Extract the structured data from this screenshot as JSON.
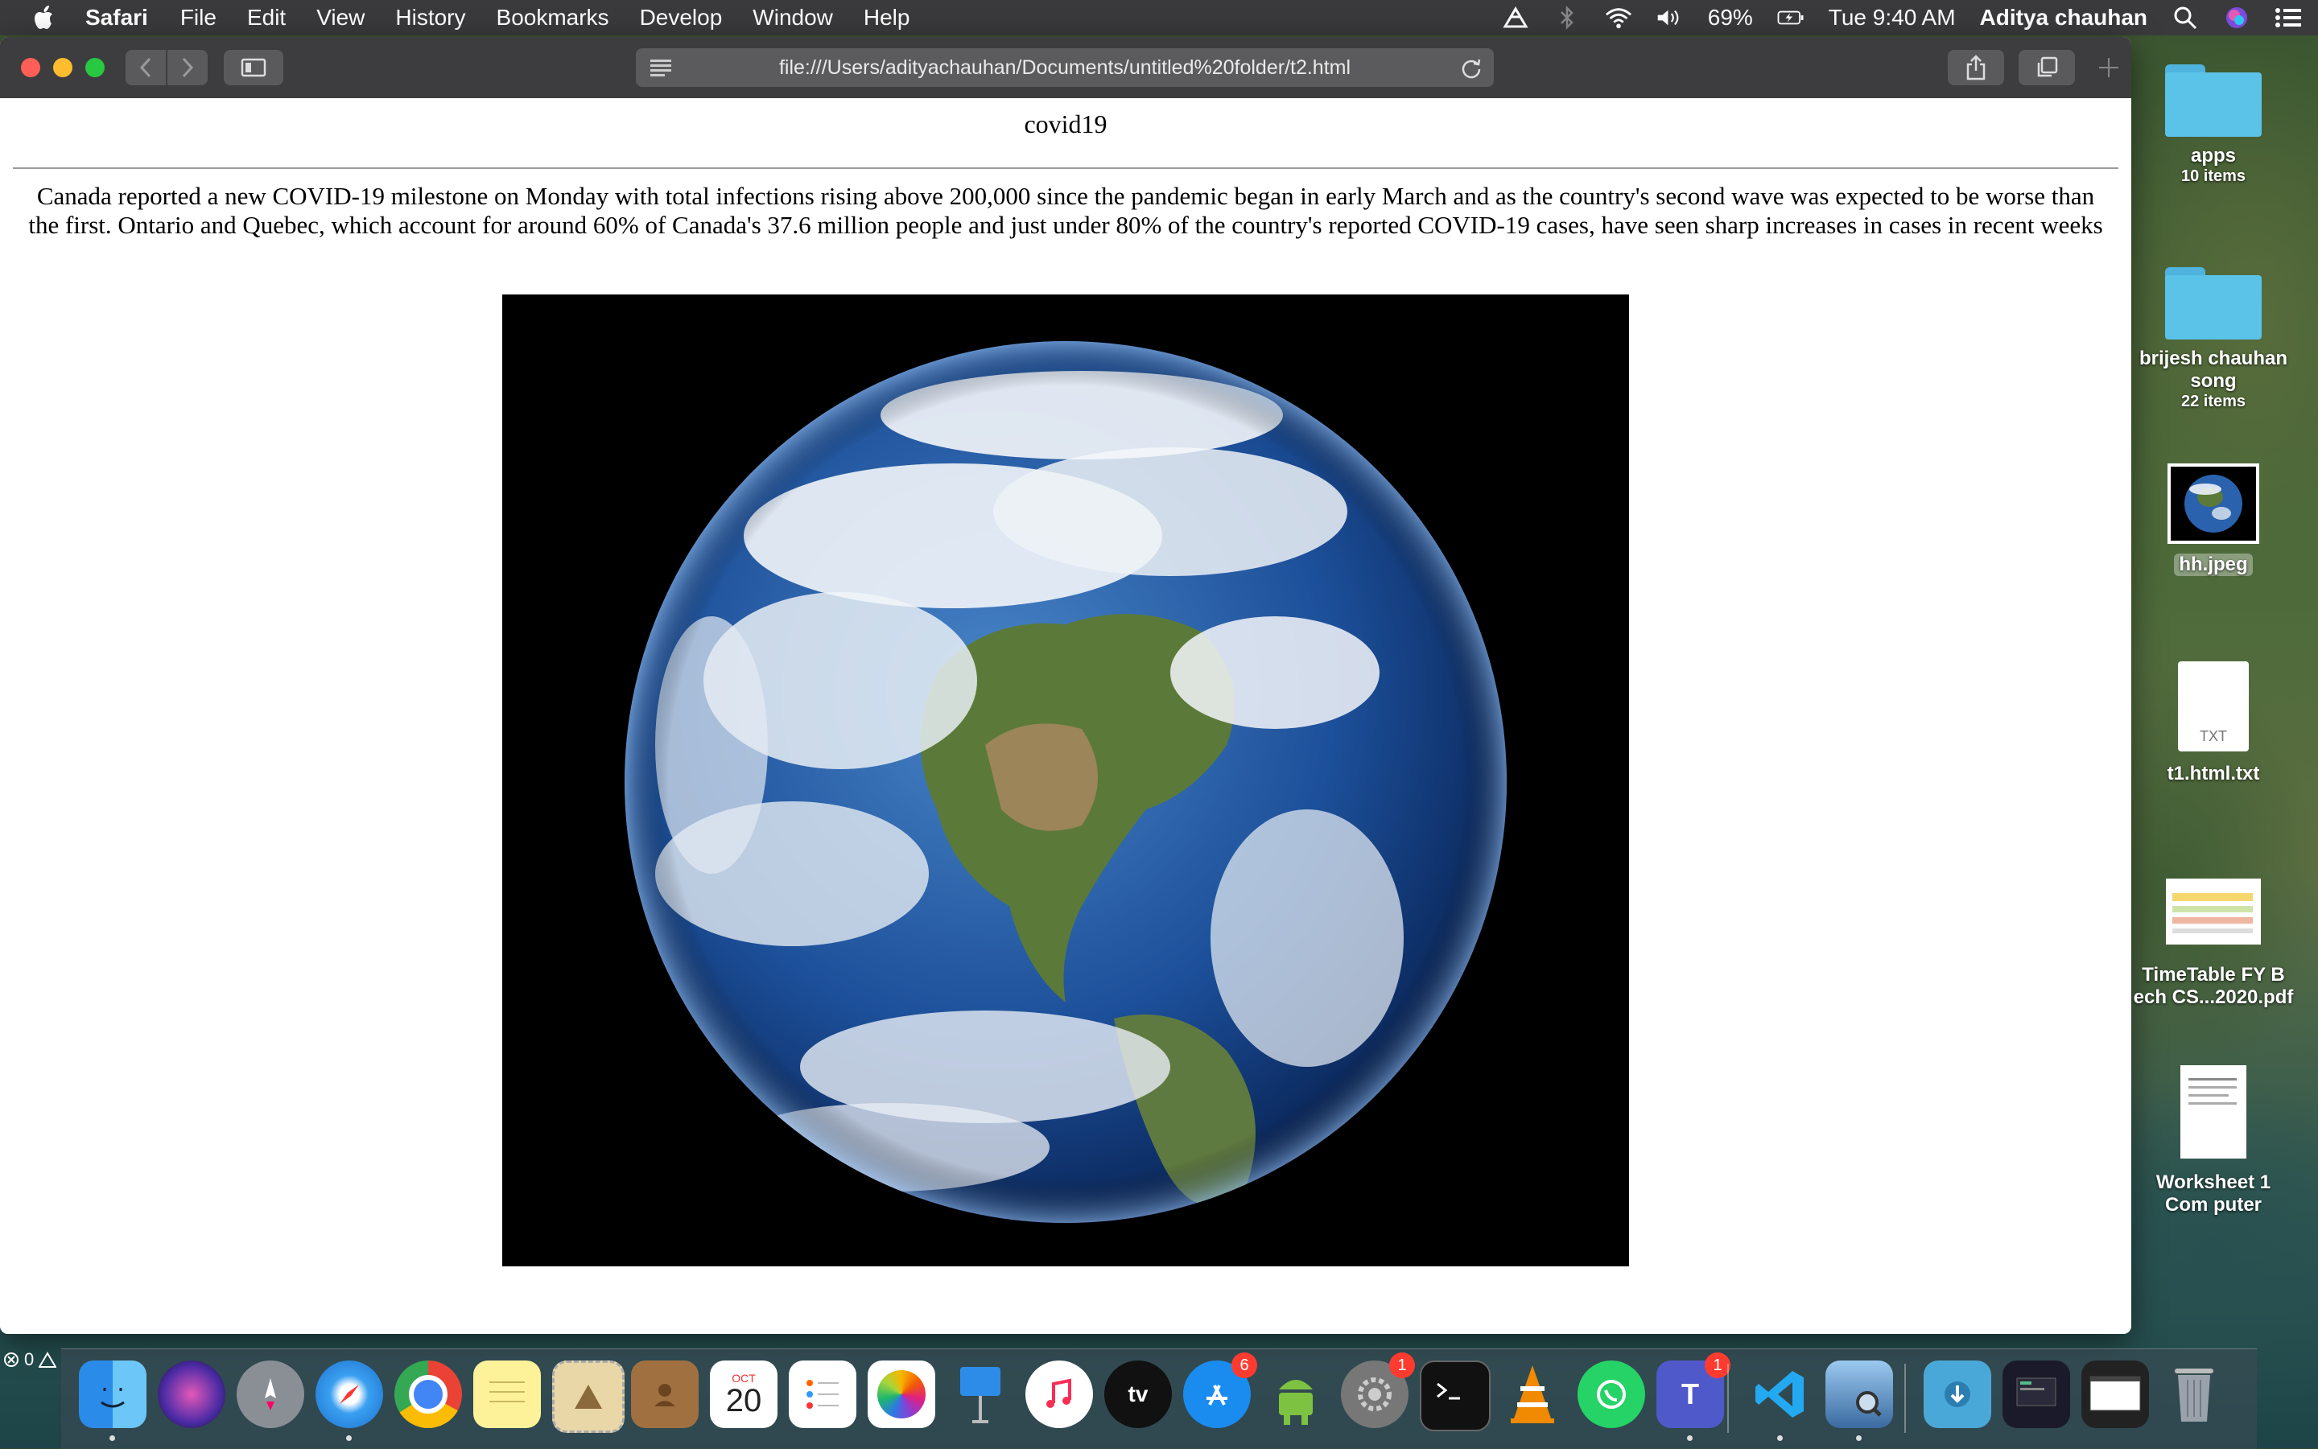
{
  "menubar": {
    "app_name": "Safari",
    "items": [
      "File",
      "Edit",
      "View",
      "History",
      "Bookmarks",
      "Develop",
      "Window",
      "Help"
    ],
    "battery": "69%",
    "clock": "Tue 9:40 AM",
    "user": "Aditya chauhan"
  },
  "browser": {
    "url": "file:///Users/adityachauhan/Documents/untitled%20folder/t2.html"
  },
  "page": {
    "title": "covid19",
    "paragraph": "Canada reported a new COVID-19 milestone on Monday with total infections rising above 200,000 since the pandemic began in early March and as the country's second wave was expected to be worse than the first. Ontario and Quebec, which account for around 60% of Canada's 37.6 million people and just under 80% of the country's reported COVID-19 cases, have seen sharp increases in cases in recent weeks"
  },
  "desktop": {
    "items": [
      {
        "name": "apps",
        "sub": "10 items"
      },
      {
        "name": "brijesh chauhan song",
        "sub": "22 items"
      },
      {
        "name": "hh.jpeg",
        "sub": ""
      },
      {
        "name": "t1.html.txt",
        "sub": "",
        "badge": "TXT"
      },
      {
        "name": "TimeTable FY B ech CS...2020.pdf",
        "sub": ""
      },
      {
        "name": "Worksheet 1 Com puter",
        "sub": ""
      }
    ]
  },
  "dock": {
    "calendar_month": "OCT",
    "calendar_day": "20",
    "appstore_badge": "6",
    "sysprefs_badge": "1",
    "teams_badge": "1",
    "tv_label": "tv",
    "status_count": "0"
  },
  "colors": {
    "menubar": "#3a3a3c",
    "toolbar": "#3d3d3f",
    "close": "#ff5f57",
    "minimize": "#febc2e",
    "maximize": "#28c840"
  }
}
